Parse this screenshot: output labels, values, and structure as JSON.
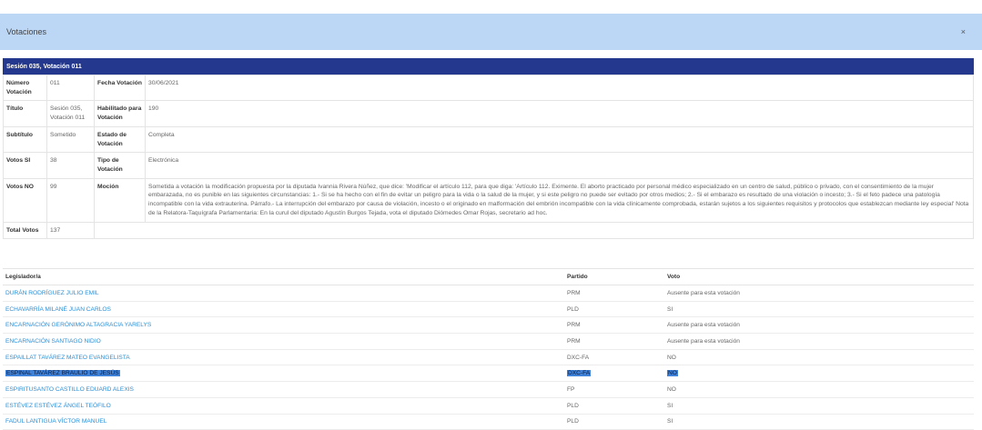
{
  "modal": {
    "title": "Votaciones",
    "close": "×"
  },
  "session_bar": "Sesión 035, Votación 011",
  "info": {
    "numero_label": "Número Votación",
    "numero": "011",
    "fecha_label": "Fecha Votación",
    "fecha": "30/06/2021",
    "titulo_label": "Título",
    "titulo": "Sesión 035, Votación 011",
    "habilitado_label": "Habilitado para Votación",
    "habilitado": "190",
    "subtitulo_label": "Subtítulo",
    "subtitulo": "Sometido",
    "estado_label": "Estado de Votación",
    "estado": "Completa",
    "votos_si_label": "Votos SI",
    "votos_si": "38",
    "tipo_label": "Tipo de Votación",
    "tipo": "Electrónica",
    "votos_no_label": "Votos NO",
    "votos_no": "99",
    "mocion_label": "Moción",
    "mocion": "Sometida a votación la modificación propuesta por la diputada Ivannia Rivera Núñez, que dice: 'Modificar el artículo 112, para que diga: 'Artículo 112. Eximente. El aborto practicado por personal médico especializado en un centro de salud, público o privado, con el consentimiento de la mujer embarazada, no es punible en las siguientes circunstancias: 1.- Si se ha hecho con el fin de evitar un peligro para la vida o la salud de la mujer, y si este peligro no puede ser evitado por otros medios; 2.- Si el embarazo es resultado de una violación o incesto; 3.- Si el feto padece una patología incompatible con la vida extrauterina. Párrafo.- La interrupción del embarazo por causa de violación, incesto o el originado en malformación del embrión incompatible con la vida clínicamente comprobada, estarán sujetos a los siguientes requisitos y protocolos que establezcan mediante ley especial' Nota de la Relatora-Taquígrafa Parlamentaria: En la curul del diputado Agustín Burgos Tejada, vota el diputado Diómedes Omar Rojas, secretario ad hoc.",
    "total_label": "Total Votos",
    "total": "137"
  },
  "list": {
    "headers": {
      "legislador": "Legislador/a",
      "partido": "Partido",
      "voto": "Voto"
    },
    "rows": [
      {
        "legislador": "DURÁN RODRÍGUEZ JULIO EMIL",
        "partido": "PRM",
        "voto": "Ausente para esta votación"
      },
      {
        "legislador": "ECHAVARRÍA MILANÉ JUAN CARLOS",
        "partido": "PLD",
        "voto": "SI"
      },
      {
        "legislador": "ENCARNACIÓN GERÓNIMO ALTAGRACIA YARELYS",
        "partido": "PRM",
        "voto": "Ausente para esta votación"
      },
      {
        "legislador": "ENCARNACIÓN SANTIAGO NIDIO",
        "partido": "PRM",
        "voto": "Ausente para esta votación"
      },
      {
        "legislador": "ESPAILLAT TAVÁREZ MATEO EVANGELISTA",
        "partido": "DXC-FA",
        "voto": "NO"
      },
      {
        "legislador": "ESPINAL TAVÁREZ BRAULIO DE JESÚS",
        "partido": "DXC-FA",
        "voto": "NO"
      },
      {
        "legislador": "ESPIRITUSANTO CASTILLO EDUARD ALEXIS",
        "partido": "FP",
        "voto": "NO"
      },
      {
        "legislador": "ESTÉVEZ ESTÉVEZ ÁNGEL TEÓFILO",
        "partido": "PLD",
        "voto": "SI"
      },
      {
        "legislador": "FADUL LANTIGUA VÍCTOR MANUEL",
        "partido": "PLD",
        "voto": "SI"
      }
    ]
  }
}
